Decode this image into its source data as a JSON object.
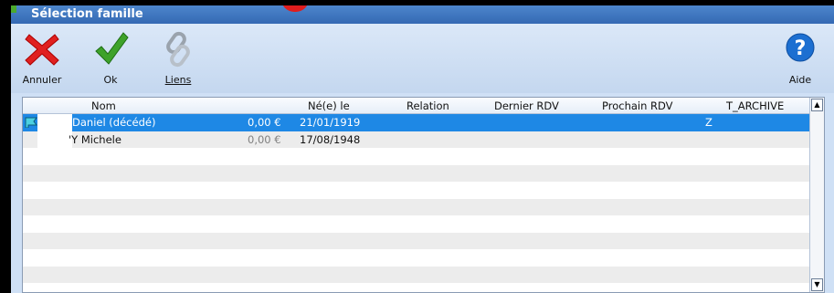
{
  "window": {
    "title": "Sélection famille"
  },
  "toolbar": {
    "cancel_label": "Annuler",
    "ok_label": "Ok",
    "links_label": "Liens",
    "help_label": "Aide"
  },
  "table": {
    "columns": [
      "Nom",
      "Né(e) le",
      "Relation",
      "Dernier RDV",
      "Prochain RDV",
      "T_ARCHIVE"
    ],
    "rows": [
      {
        "nom": "Daniel (décédé)",
        "montant": "0,00 €",
        "ne_le": "21/01/1919",
        "relation": "",
        "dernier_rdv": "",
        "prochain_rdv": "",
        "t_archive": "Z",
        "selected": true,
        "icon": "flag-icon"
      },
      {
        "nom": "'Y Michele",
        "montant": "0,00 €",
        "ne_le": "17/08/1948",
        "relation": "",
        "dernier_rdv": "",
        "prochain_rdv": "",
        "t_archive": "",
        "selected": false
      }
    ]
  },
  "colors": {
    "selection": "#1e88e5",
    "titlebar": "#3f79c2",
    "cancel_icon": "#e02020",
    "ok_icon": "#3ea22a",
    "help_icon": "#1c6fd1"
  }
}
